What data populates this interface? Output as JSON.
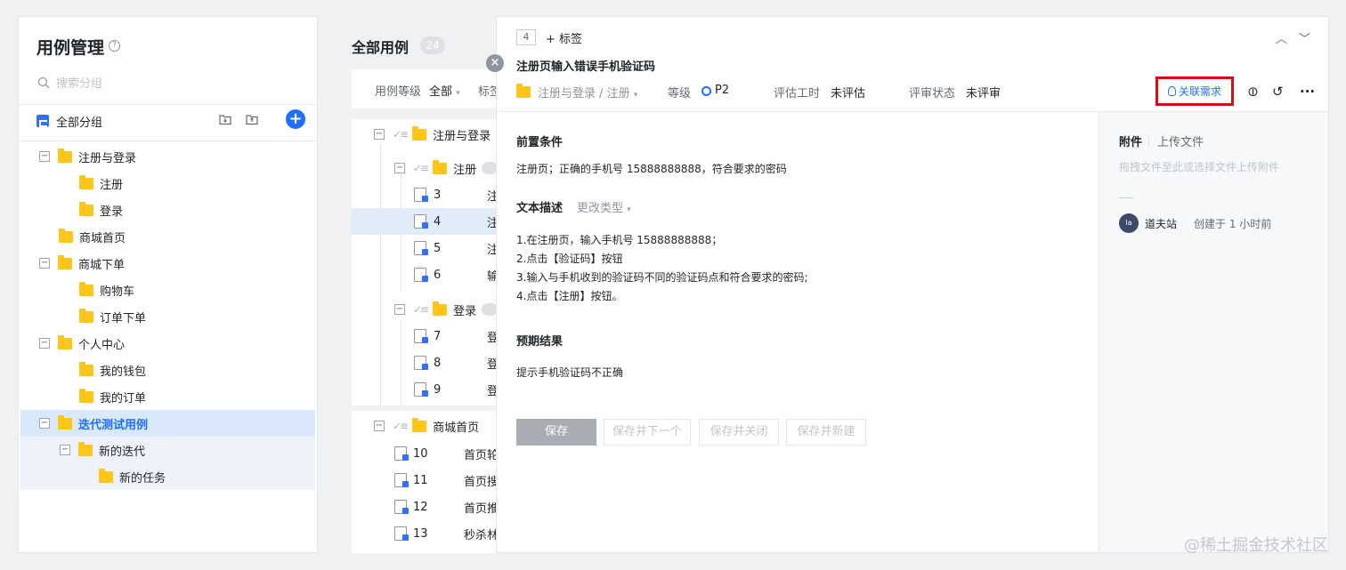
{
  "sidebar": {
    "title": "用例管理",
    "help_icon_text": "?",
    "search_placeholder": "搜索分组",
    "all_groups": "全部分组",
    "add_icon_text": "+",
    "tree": [
      {
        "label": "注册与登录",
        "toggle": "−"
      },
      {
        "label": "注册"
      },
      {
        "label": "登录"
      },
      {
        "label": "商城首页"
      },
      {
        "label": "商城下单",
        "toggle": "−"
      },
      {
        "label": "购物车"
      },
      {
        "label": "订单下单"
      },
      {
        "label": "个人中心",
        "toggle": "−"
      },
      {
        "label": "我的钱包"
      },
      {
        "label": "我的订单"
      },
      {
        "label": "迭代测试用例",
        "toggle": "−"
      },
      {
        "label": "新的迭代",
        "toggle": "−"
      },
      {
        "label": "新的任务"
      }
    ]
  },
  "list": {
    "title": "全部用例",
    "count": "24",
    "filter_label": "用例等级",
    "filter_value": "全部",
    "filter_caret": "▾",
    "filter_next": "标签",
    "toggle_text": "−",
    "check_text": "✓≡",
    "groups": [
      {
        "label": "注册与登录"
      },
      {
        "label": "注册"
      },
      {
        "label": "登录"
      },
      {
        "label": "商城首页"
      }
    ],
    "rows": [
      {
        "num": "3",
        "title": "注"
      },
      {
        "num": "4",
        "title": "注"
      },
      {
        "num": "5",
        "title": "注"
      },
      {
        "num": "6",
        "title": "输"
      },
      {
        "num": "7",
        "title": "登"
      },
      {
        "num": "8",
        "title": "登"
      },
      {
        "num": "9",
        "title": "登"
      },
      {
        "num": "10",
        "title": "首页轮"
      },
      {
        "num": "11",
        "title": "首页搜"
      },
      {
        "num": "12",
        "title": "首页推"
      },
      {
        "num": "13",
        "title": "秒杀林"
      }
    ]
  },
  "detail": {
    "close_icon_text": "×",
    "id": "4",
    "tag_add": "+ 标签",
    "nav_up": "︿",
    "nav_down": "﹀",
    "title": "注册页输入错误手机验证码",
    "path": "注册与登录 / 注册",
    "path_caret": "▾",
    "level_label": "等级",
    "level_value": "P2",
    "estimate_label": "评估工时",
    "estimate_value": "未评估",
    "review_label": "评审状态",
    "review_value": "未评审",
    "assoc_button": "关联需求",
    "attach_icon_text": "⊘",
    "history_icon_text": "↺",
    "more_icon_text": "···",
    "precondition_title": "前置条件",
    "precondition_text": "注册页；正确的手机号 15888888888，符合要求的密码",
    "desc_title": "文本描述",
    "change_type": "更改类型",
    "change_type_caret": "▾",
    "steps": [
      "1.在注册页，输入手机号 15888888888；",
      "2.点击【验证码】按钮",
      "3.输入与手机收到的验证码不同的验证码点和符合要求的密码;",
      "4.点击【注册】按钮。"
    ],
    "expected_title": "预期结果",
    "expected_text": "提示手机验证码不正确",
    "buttons": {
      "save": "保存",
      "save_next": "保存并下一个",
      "save_close": "保存并关闭",
      "save_new": "保存并新建"
    },
    "attachments": {
      "title": "附件",
      "upload": "上传文件",
      "hint": "拖拽文件至此或选择文件上传附件",
      "avatar_text": "la",
      "creator": "道夫站",
      "created_at": "创建于 1 小时前"
    }
  },
  "watermark": "@稀土掘金技术社区",
  "colors": {
    "accent": "#1f6fff",
    "folder": "#ffc51a",
    "highlight_border": "#d40f14",
    "selected_row": "#d9e8fb"
  }
}
